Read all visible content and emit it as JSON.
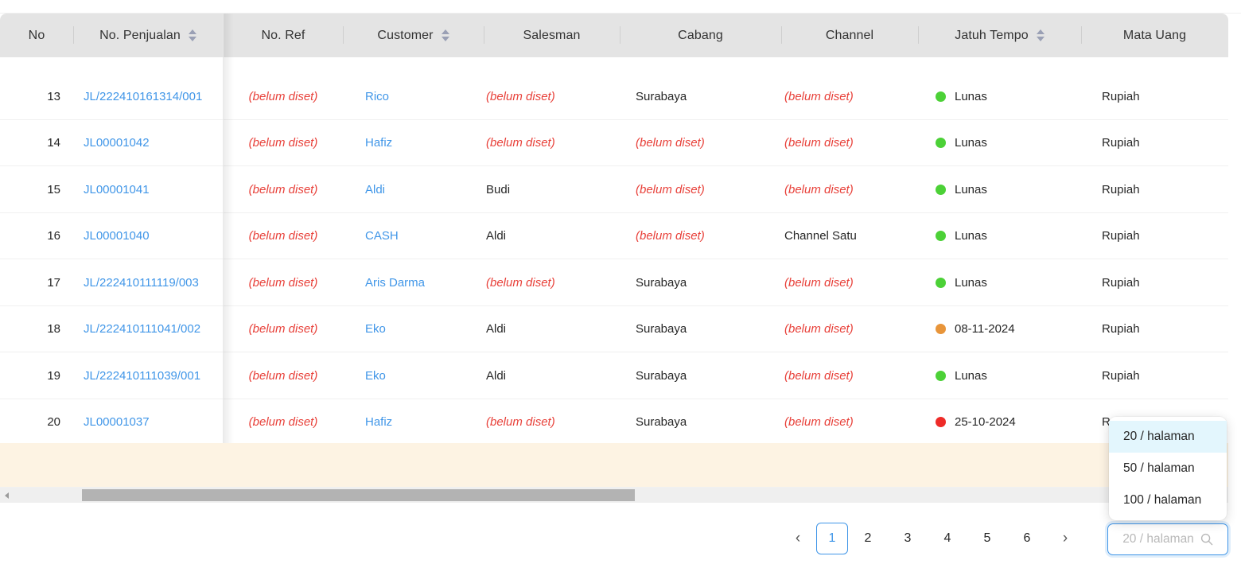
{
  "colors": {
    "link": "#4096e8",
    "unset_text": "#e8413a",
    "header_bg": "#e4e4e4",
    "status_paid": "#4cd137",
    "status_due_soon": "#e8953a",
    "status_overdue": "#ee2b28",
    "summary_strip": "#fdf3e3",
    "accent": "#4096e8",
    "dropdown_selected_bg": "#e3f6fd"
  },
  "table": {
    "columns": [
      {
        "key": "no",
        "label": "No",
        "sortable": false
      },
      {
        "key": "no_penjualan",
        "label": "No. Penjualan",
        "sortable": true
      },
      {
        "key": "no_ref",
        "label": "No. Ref",
        "sortable": false
      },
      {
        "key": "customer",
        "label": "Customer",
        "sortable": true
      },
      {
        "key": "salesman",
        "label": "Salesman",
        "sortable": false
      },
      {
        "key": "cabang",
        "label": "Cabang",
        "sortable": false
      },
      {
        "key": "channel",
        "label": "Channel",
        "sortable": false
      },
      {
        "key": "jatuh_tempo",
        "label": "Jatuh Tempo",
        "sortable": true
      },
      {
        "key": "mata_uang",
        "label": "Mata Uang",
        "sortable": false
      }
    ],
    "unset_label": "(belum diset)",
    "rows": [
      {
        "no": "13",
        "no_penjualan": "JL/222410161314/001",
        "no_ref": "(belum diset)",
        "customer": "Rico",
        "salesman": "(belum diset)",
        "cabang": "Surabaya",
        "channel": "(belum diset)",
        "jatuh_tempo": "Lunas",
        "jatuh_tempo_status": "paid",
        "mata_uang": "Rupiah"
      },
      {
        "no": "14",
        "no_penjualan": "JL00001042",
        "no_ref": "(belum diset)",
        "customer": "Hafiz",
        "salesman": "(belum diset)",
        "cabang": "(belum diset)",
        "channel": "(belum diset)",
        "jatuh_tempo": "Lunas",
        "jatuh_tempo_status": "paid",
        "mata_uang": "Rupiah"
      },
      {
        "no": "15",
        "no_penjualan": "JL00001041",
        "no_ref": "(belum diset)",
        "customer": "Aldi",
        "salesman": "Budi",
        "cabang": "(belum diset)",
        "channel": "(belum diset)",
        "jatuh_tempo": "Lunas",
        "jatuh_tempo_status": "paid",
        "mata_uang": "Rupiah"
      },
      {
        "no": "16",
        "no_penjualan": "JL00001040",
        "no_ref": "(belum diset)",
        "customer": "CASH",
        "salesman": "Aldi",
        "cabang": "(belum diset)",
        "channel": "Channel Satu",
        "jatuh_tempo": "Lunas",
        "jatuh_tempo_status": "paid",
        "mata_uang": "Rupiah"
      },
      {
        "no": "17",
        "no_penjualan": "JL/222410111119/003",
        "no_ref": "(belum diset)",
        "customer": "Aris Darma",
        "salesman": "(belum diset)",
        "cabang": "Surabaya",
        "channel": "(belum diset)",
        "jatuh_tempo": "Lunas",
        "jatuh_tempo_status": "paid",
        "mata_uang": "Rupiah"
      },
      {
        "no": "18",
        "no_penjualan": "JL/222410111041/002",
        "no_ref": "(belum diset)",
        "customer": "Eko",
        "salesman": "Aldi",
        "cabang": "Surabaya",
        "channel": "(belum diset)",
        "jatuh_tempo": "08-11-2024",
        "jatuh_tempo_status": "due_soon",
        "mata_uang": "Rupiah"
      },
      {
        "no": "19",
        "no_penjualan": "JL/222410111039/001",
        "no_ref": "(belum diset)",
        "customer": "Eko",
        "salesman": "Aldi",
        "cabang": "Surabaya",
        "channel": "(belum diset)",
        "jatuh_tempo": "Lunas",
        "jatuh_tempo_status": "paid",
        "mata_uang": "Rupiah"
      },
      {
        "no": "20",
        "no_penjualan": "JL00001037",
        "no_ref": "(belum diset)",
        "customer": "Hafiz",
        "salesman": "(belum diset)",
        "cabang": "Surabaya",
        "channel": "(belum diset)",
        "jatuh_tempo": "25-10-2024",
        "jatuh_tempo_status": "overdue",
        "mata_uang": "Rupiah"
      }
    ]
  },
  "pagination": {
    "prev_label": "‹",
    "next_label": "›",
    "pages": [
      "1",
      "2",
      "3",
      "4",
      "5",
      "6"
    ],
    "active_page": "1"
  },
  "page_size": {
    "value": "20 / halaman",
    "placeholder": "20 / halaman",
    "search_icon": "search-icon",
    "options": [
      "20 / halaman",
      "50 / halaman",
      "100 / halaman"
    ],
    "selected_option": "20 / halaman"
  }
}
